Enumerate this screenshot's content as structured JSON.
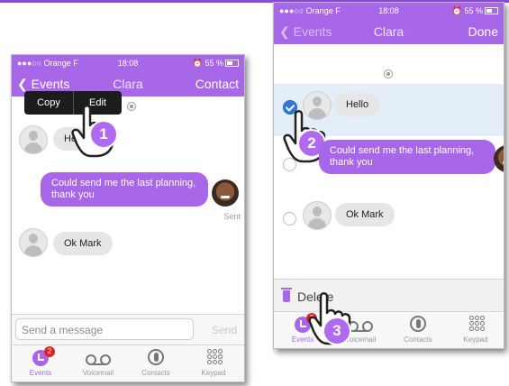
{
  "colors": {
    "accent": "#a867e8",
    "selected_row": "#e4eef9",
    "checkmark": "#2e79d8",
    "badge": "#e02222"
  },
  "status": {
    "carrier": "●●●○○ Orange F",
    "wifi": "wifi-icon",
    "time": "18:08",
    "battery": "55 %"
  },
  "screen1": {
    "nav": {
      "back": "Events",
      "title": "Clara",
      "action": "Contact"
    },
    "popup": {
      "copy": "Copy",
      "edit": "Edit"
    },
    "messages": [
      {
        "from": "contact",
        "text": "He"
      },
      {
        "from": "me",
        "text": "Could send me the last planning, thank you",
        "status": "Sent"
      },
      {
        "from": "contact",
        "text": "Ok Mark"
      }
    ],
    "composer": {
      "placeholder": "Send a message",
      "send": "Send"
    },
    "step": "1"
  },
  "screen2": {
    "nav": {
      "back": "Events",
      "title": "Clara",
      "action": "Done"
    },
    "messages": [
      {
        "from": "contact",
        "text": "Hello",
        "selected": true
      },
      {
        "from": "me",
        "text": "Could send me the last planning, thank you"
      },
      {
        "from": "contact",
        "text": "Ok Mark"
      }
    ],
    "delete_label": "Delete",
    "step2": "2",
    "step3": "3"
  },
  "tabs": [
    {
      "label": "Events",
      "icon": "events-icon",
      "badge": "2",
      "active": true
    },
    {
      "label": "Voicemail",
      "icon": "voicemail-icon"
    },
    {
      "label": "Contacts",
      "icon": "contacts-icon"
    },
    {
      "label": "Keypad",
      "icon": "keypad-icon"
    }
  ]
}
